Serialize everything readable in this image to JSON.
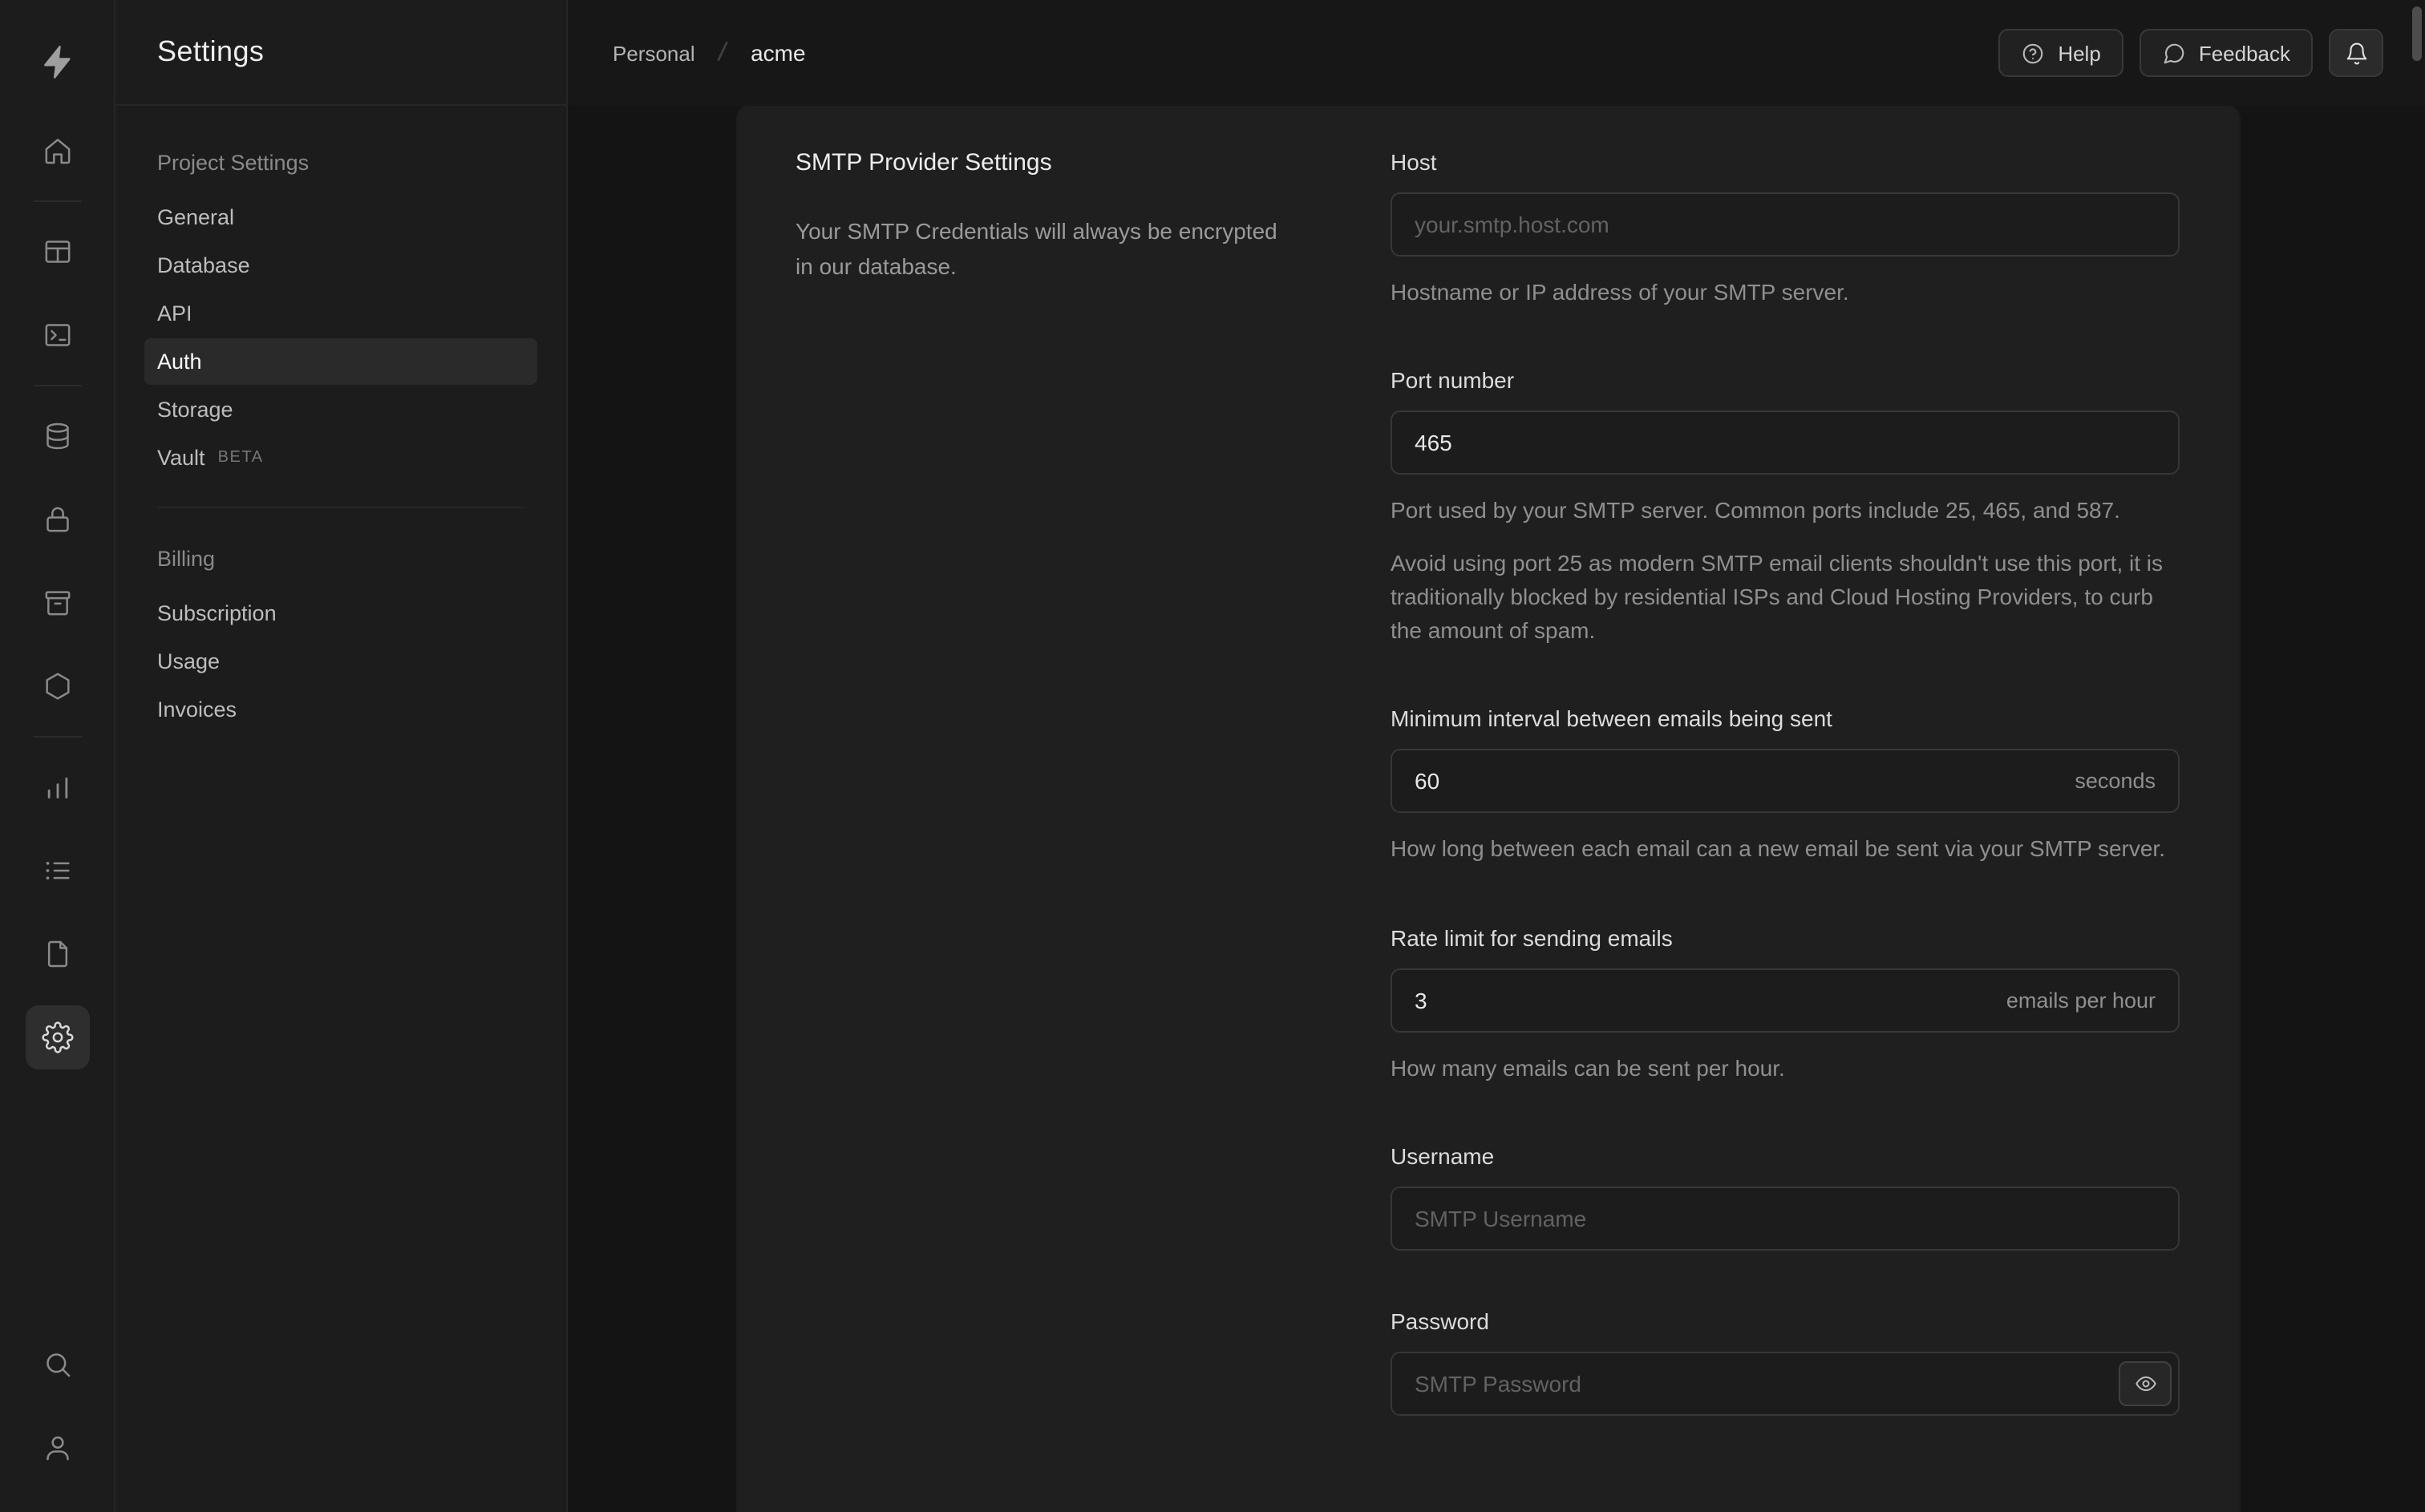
{
  "colors": {
    "page_bg": "#171717",
    "rail_bg": "#1c1c1c",
    "panel_bg": "#1f1f1f",
    "input_bg": "#1c1c1c",
    "border": "#373737",
    "text_primary": "#ededed",
    "text_muted": "#8f8f8f",
    "active_item_bg": "#2a2a2a"
  },
  "icon_rail": {
    "logo_icon": "supabase-bolt-icon",
    "items": [
      "home-icon",
      "table-editor-icon",
      "sql-editor-icon",
      "database-icon",
      "auth-lock-icon",
      "storage-icon",
      "edge-functions-icon",
      "reports-icon",
      "logs-icon",
      "docs-icon",
      "settings-gear-icon"
    ],
    "active_item": "settings-gear-icon",
    "bottom_items": [
      "search-icon",
      "user-icon"
    ]
  },
  "sidebar": {
    "title": "Settings",
    "sections": [
      {
        "heading": "Project Settings",
        "items": [
          {
            "label": "General",
            "active": false
          },
          {
            "label": "Database",
            "active": false
          },
          {
            "label": "API",
            "active": false
          },
          {
            "label": "Auth",
            "active": true
          },
          {
            "label": "Storage",
            "active": false
          },
          {
            "label": "Vault",
            "active": false,
            "badge": "BETA"
          }
        ]
      },
      {
        "heading": "Billing",
        "items": [
          {
            "label": "Subscription",
            "active": false
          },
          {
            "label": "Usage",
            "active": false
          },
          {
            "label": "Invoices",
            "active": false
          }
        ]
      }
    ]
  },
  "header": {
    "breadcrumb": {
      "org": "Personal",
      "separator": "/",
      "project": "acme"
    },
    "buttons": {
      "help": "Help",
      "feedback": "Feedback"
    }
  },
  "panel": {
    "title": "SMTP Provider Settings",
    "description": "Your SMTP Credentials will always be encrypted in our database.",
    "fields": {
      "host": {
        "label": "Host",
        "placeholder": "your.smtp.host.com",
        "help": "Hostname or IP address of your SMTP server."
      },
      "port": {
        "label": "Port number",
        "value": "465",
        "help": "Port used by your SMTP server. Common ports include 25, 465, and 587.",
        "note": "Avoid using port 25 as modern SMTP email clients shouldn't use this port, it is traditionally blocked by residential ISPs and Cloud Hosting Providers, to curb the amount of spam."
      },
      "interval": {
        "label": "Minimum interval between emails being sent",
        "value": "60",
        "suffix": "seconds",
        "help": "How long between each email can a new email be sent via your SMTP server."
      },
      "rate": {
        "label": "Rate limit for sending emails",
        "value": "3",
        "suffix": "emails per hour",
        "help": "How many emails can be sent per hour."
      },
      "username": {
        "label": "Username",
        "placeholder": "SMTP Username"
      },
      "password": {
        "label": "Password",
        "placeholder": "SMTP Password"
      }
    }
  }
}
